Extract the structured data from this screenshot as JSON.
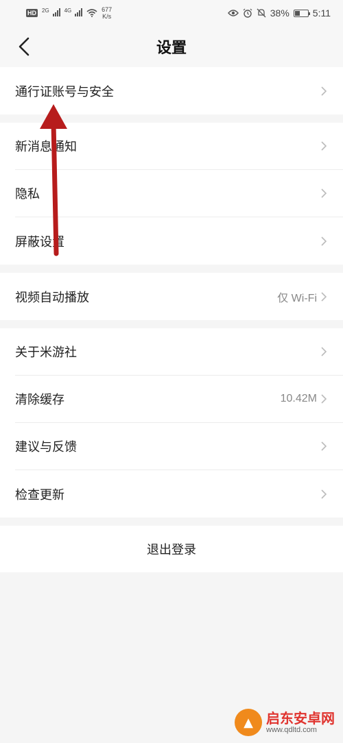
{
  "status_bar": {
    "hd": "HD",
    "net1": "2G",
    "net2": "4G",
    "speed_value": "677",
    "speed_unit": "K/s",
    "battery": "38%",
    "battery_level": 0.38,
    "time": "5:11"
  },
  "header": {
    "title": "设置"
  },
  "groups": [
    {
      "items": [
        {
          "label": "通行证账号与安全",
          "value": ""
        }
      ]
    },
    {
      "items": [
        {
          "label": "新消息通知",
          "value": ""
        },
        {
          "label": "隐私",
          "value": ""
        },
        {
          "label": "屏蔽设置",
          "value": ""
        }
      ]
    },
    {
      "items": [
        {
          "label": "视频自动播放",
          "value": "仅 Wi-Fi"
        }
      ]
    },
    {
      "items": [
        {
          "label": "关于米游社",
          "value": ""
        },
        {
          "label": "清除缓存",
          "value": "10.42M"
        },
        {
          "label": "建议与反馈",
          "value": ""
        },
        {
          "label": "检查更新",
          "value": ""
        }
      ]
    }
  ],
  "logout_label": "退出登录",
  "watermark": {
    "title": "启东安卓网",
    "url": "www.qdltd.com"
  },
  "colors": {
    "background": "#f5f5f5",
    "annotation_arrow": "#b71c1c",
    "watermark_red": "#e0342f"
  }
}
